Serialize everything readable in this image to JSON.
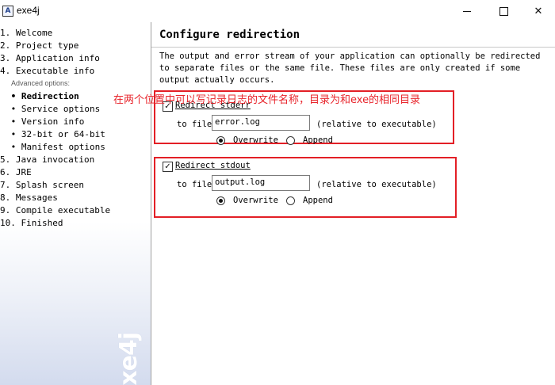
{
  "window": {
    "icon_glyph": "A",
    "title": "exe4j",
    "minimize_icon": "minimize-icon",
    "maximize_icon": "maximize-icon",
    "close_icon": "close-icon",
    "close_glyph": "✕"
  },
  "sidebar": {
    "steps": [
      {
        "text": "1. Welcome"
      },
      {
        "text": "2. Project type"
      },
      {
        "text": "3. Application info"
      },
      {
        "text": "4. Executable info"
      }
    ],
    "advanced_label": "Advanced options:",
    "sub_steps": [
      {
        "text": " • Redirection",
        "active": true
      },
      {
        "text": " • Service options"
      },
      {
        "text": " • Version info"
      },
      {
        "text": " • 32-bit or 64-bit"
      },
      {
        "text": " • Manifest options"
      }
    ],
    "steps_after": [
      {
        "text": "5. Java invocation"
      },
      {
        "text": "6. JRE"
      },
      {
        "text": "7. Splash screen"
      },
      {
        "text": "8. Messages"
      },
      {
        "text": "9. Compile executable"
      },
      {
        "text": "10. Finished"
      }
    ],
    "logo_text": "exe4j"
  },
  "main": {
    "heading": "Configure redirection",
    "description": "The output and error stream of your application can optionally be redirected to separate files or the same file. These files are only created if some output actually occurs.",
    "annotation": "在两个位置中可以写记录日志的文件名称，目录为和exe的相同目录",
    "stderr": {
      "checkbox_label": "Redirect stderr",
      "checked": true,
      "to_file_label": "to file",
      "file_value": "error.log",
      "relative_label": "(relative to executable)",
      "overwrite_label": "Overwrite",
      "append_label": "Append",
      "selected": "Overwrite"
    },
    "stdout": {
      "checkbox_label": "Redirect stdout",
      "checked": true,
      "to_file_label": "to file",
      "file_value": "output.log",
      "relative_label": "(relative to executable)",
      "overwrite_label": "Overwrite",
      "append_label": "Append",
      "selected": "Overwrite"
    }
  },
  "colors": {
    "annotation_red": "#e31f26",
    "sidebar_gradient_end": "#d3dbee"
  }
}
